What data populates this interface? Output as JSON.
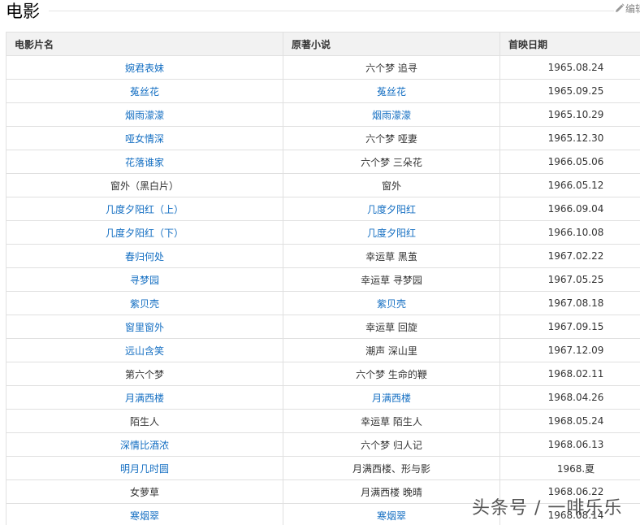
{
  "section": {
    "title": "电影",
    "edit_label": "编辑"
  },
  "table": {
    "headers": [
      "电影片名",
      "原著小说",
      "首映日期"
    ],
    "rows": [
      {
        "film": "婉君表妹",
        "film_link": true,
        "novel": "六个梦 追寻",
        "novel_link": false,
        "date": "1965.08.24"
      },
      {
        "film": "菟丝花",
        "film_link": true,
        "novel": "菟丝花",
        "novel_link": true,
        "date": "1965.09.25"
      },
      {
        "film": "烟雨濛濛",
        "film_link": true,
        "novel": "烟雨濛濛",
        "novel_link": true,
        "date": "1965.10.29"
      },
      {
        "film": "哑女情深",
        "film_link": true,
        "novel": "六个梦 哑妻",
        "novel_link": false,
        "date": "1965.12.30"
      },
      {
        "film": "花落谁家",
        "film_link": true,
        "novel": "六个梦 三朵花",
        "novel_link": false,
        "date": "1966.05.06"
      },
      {
        "film": "窗外（黑白片）",
        "film_link": false,
        "novel": "窗外",
        "novel_link": false,
        "date": "1966.05.12"
      },
      {
        "film": "几度夕阳红（上）",
        "film_link": true,
        "novel": "几度夕阳红",
        "novel_link": true,
        "date": "1966.09.04"
      },
      {
        "film": "几度夕阳红（下）",
        "film_link": true,
        "novel": "几度夕阳红",
        "novel_link": true,
        "date": "1966.10.08"
      },
      {
        "film": "春归何处",
        "film_link": true,
        "novel": "幸运草 黑茧",
        "novel_link": false,
        "date": "1967.02.22"
      },
      {
        "film": "寻梦园",
        "film_link": true,
        "novel": "幸运草 寻梦园",
        "novel_link": false,
        "date": "1967.05.25"
      },
      {
        "film": "紫贝壳",
        "film_link": true,
        "novel": "紫贝壳",
        "novel_link": true,
        "date": "1967.08.18"
      },
      {
        "film": "窗里窗外",
        "film_link": true,
        "novel": "幸运草 回旋",
        "novel_link": false,
        "date": "1967.09.15"
      },
      {
        "film": "远山含笑",
        "film_link": true,
        "novel": "潮声 深山里",
        "novel_link": false,
        "date": "1967.12.09"
      },
      {
        "film": "第六个梦",
        "film_link": false,
        "novel": "六个梦 生命的鞭",
        "novel_link": false,
        "date": "1968.02.11"
      },
      {
        "film": "月满西楼",
        "film_link": true,
        "novel": "月满西楼",
        "novel_link": true,
        "date": "1968.04.26"
      },
      {
        "film": "陌生人",
        "film_link": false,
        "novel": "幸运草 陌生人",
        "novel_link": false,
        "date": "1968.05.24"
      },
      {
        "film": "深情比酒浓",
        "film_link": true,
        "novel": "六个梦 归人记",
        "novel_link": false,
        "date": "1968.06.13"
      },
      {
        "film": "明月几时圆",
        "film_link": true,
        "novel": "月满西楼、形与影",
        "novel_link": false,
        "date": "1968.夏"
      },
      {
        "film": "女萝草",
        "film_link": false,
        "novel": "月满西楼 晚晴",
        "novel_link": false,
        "date": "1968.06.22"
      },
      {
        "film": "寒烟翠",
        "film_link": true,
        "novel": "寒烟翠",
        "novel_link": true,
        "date": "1968.08.14"
      }
    ]
  },
  "watermark": {
    "text": "头条号 / 一啡乐乐"
  },
  "colors": {
    "link": "#136ec2",
    "text": "#333333",
    "header_bg": "#f2f2f2",
    "border": "#e0e0e0"
  }
}
